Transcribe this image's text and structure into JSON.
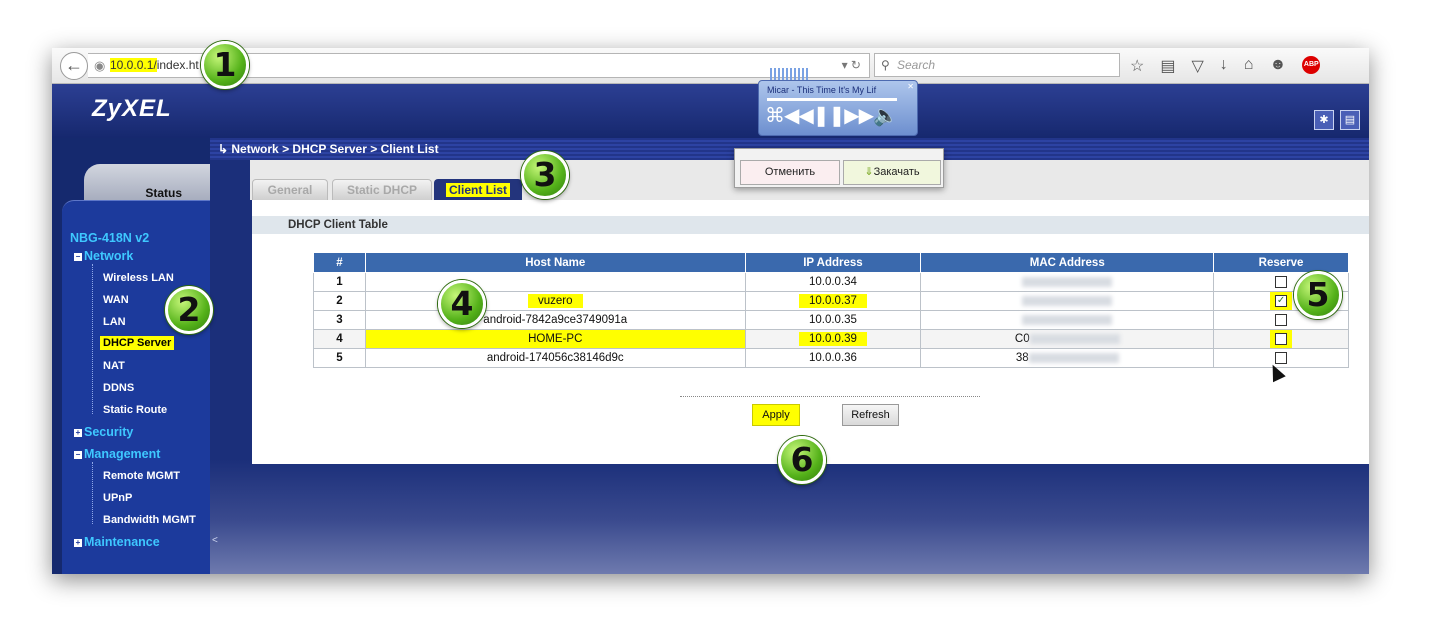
{
  "browser": {
    "url_highlight": "10.0.0.1/",
    "url_rest": "index.ht",
    "search_placeholder": "Search"
  },
  "header": {
    "logo": "ZyXEL"
  },
  "player": {
    "title": "Micar  - This Time It's My Lif"
  },
  "popup": {
    "cancel": "Отменить",
    "download": "Закачать"
  },
  "breadcrumb": "Network > DHCP Server > Client List",
  "sidebar": {
    "status_tab": "Status",
    "device": "NBG-418N v2",
    "network": "Network",
    "wireless": "Wireless LAN",
    "wan": "WAN",
    "lan": "LAN",
    "dhcp": "DHCP Server",
    "nat": "NAT",
    "ddns": "DDNS",
    "static_route": "Static Route",
    "security": "Security",
    "management": "Management",
    "remote": "Remote MGMT",
    "upnp": "UPnP",
    "bandwidth": "Bandwidth MGMT",
    "maintenance": "Maintenance",
    "collapse": "<"
  },
  "tabs": {
    "general": "General",
    "static": "Static DHCP",
    "client": "Client List"
  },
  "panel_title": "DHCP Client Table",
  "table": {
    "headers": [
      "#",
      "Host Name",
      "IP Address",
      "MAC Address",
      "Reserve"
    ],
    "rows": [
      {
        "num": "1",
        "host": "",
        "ip": "10.0.0.34",
        "mac": "",
        "reserve": false
      },
      {
        "num": "2",
        "host": "vuzero",
        "ip": "10.0.0.37",
        "mac": "",
        "reserve": true
      },
      {
        "num": "3",
        "host": "android-7842a9ce3749091a",
        "ip": "10.0.0.35",
        "mac": "",
        "reserve": false
      },
      {
        "num": "4",
        "host": "HOME-PC",
        "ip": "10.0.0.39",
        "mac": "C0",
        "reserve": false
      },
      {
        "num": "5",
        "host": "android-174056c38146d9c",
        "ip": "10.0.0.36",
        "mac": "38",
        "reserve": false
      }
    ]
  },
  "buttons": {
    "apply": "Apply",
    "refresh": "Refresh"
  },
  "badges": [
    "1",
    "2",
    "3",
    "4",
    "5",
    "6"
  ],
  "colors": {
    "highlight": "#ffff00",
    "header_blue": "#3a69ad",
    "nav_bg": "#1c3a9c",
    "badge_green": "#55b21a"
  }
}
